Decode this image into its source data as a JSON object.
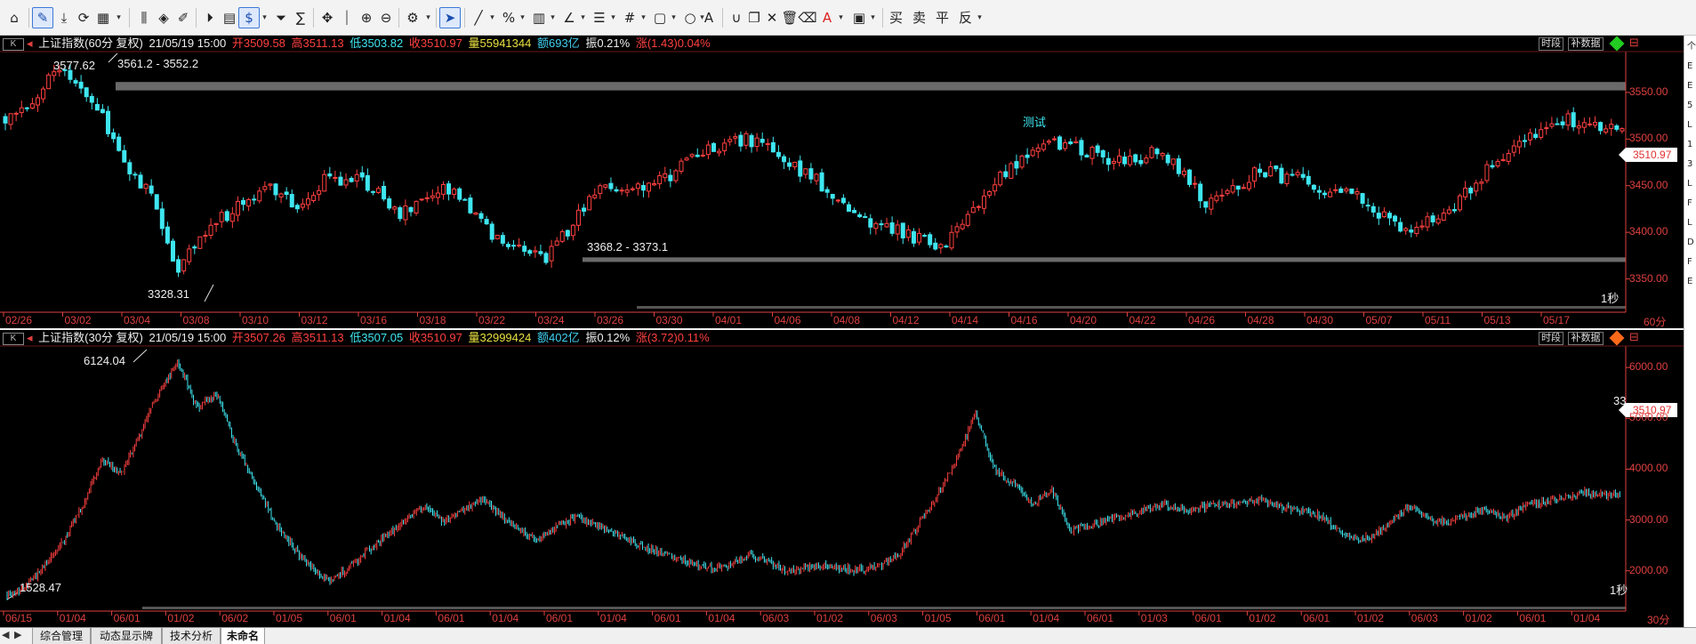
{
  "toolbar": {
    "buttons": [
      "home-icon",
      "draw-icon",
      "download-icon",
      "refresh-icon",
      "layout-icon",
      "indicator-icon",
      "diamond-icon",
      "edit-icon",
      "play-icon",
      "clipboard-icon",
      "dollar-icon",
      "funnel-icon",
      "formula-icon",
      "move-icon",
      "cursor-line-icon",
      "zoom-in-icon",
      "zoom-out-icon",
      "settings-icon",
      "pointer-icon",
      "line-tool-icon",
      "percent-icon",
      "ruler-icon",
      "angle-icon",
      "parallel-icon",
      "grid-icon",
      "rect-icon",
      "circle-icon",
      "text-icon",
      "magnet-icon",
      "copy-icon",
      "delete-icon",
      "lock-icon",
      "erase-icon",
      "color-icon",
      "save-icon"
    ],
    "text_buttons": [
      "买",
      "卖",
      "平",
      "反"
    ]
  },
  "top_panel": {
    "index_name": "上证指数(60分 复权)",
    "date_time": "21/05/19 15:00",
    "open_label": "开",
    "open": "3509.58",
    "high_label": "高",
    "high": "3511.13",
    "low_label": "低",
    "low": "3503.82",
    "close_label": "收",
    "close": "3510.97",
    "volume_label": "量",
    "volume": "55941344",
    "amount_label": "额",
    "amount": "693亿",
    "amp_label": "振",
    "amp": "0.21%",
    "change_label": "涨",
    "change": "(1.43)0.04%",
    "btn_time": "时段",
    "btn_fill": "补数据",
    "period": "60分",
    "interval": "1秒",
    "note": "测试",
    "max_label": "3577.62",
    "min_label": "3328.31",
    "band_top": "3561.2 - 3552.2",
    "band_bottom": "3368.2 - 3373.1",
    "last_price": "3510.97",
    "y_ticks": [
      "3550.00",
      "3500.00",
      "3450.00",
      "3400.00",
      "3350.00"
    ],
    "x_ticks": [
      "02/26",
      "03/02",
      "03/04",
      "03/08",
      "03/10",
      "03/12",
      "03/16",
      "03/18",
      "03/22",
      "03/24",
      "03/26",
      "03/30",
      "04/01",
      "04/06",
      "04/08",
      "04/12",
      "04/14",
      "04/16",
      "04/20",
      "04/22",
      "04/26",
      "04/28",
      "04/30",
      "05/07",
      "05/11",
      "05/13",
      "05/17"
    ]
  },
  "bottom_panel": {
    "index_name": "上证指数(30分 复权)",
    "date_time": "21/05/19 15:00",
    "open_label": "开",
    "open": "3507.26",
    "high_label": "高",
    "high": "3511.13",
    "low_label": "低",
    "low": "3507.05",
    "close_label": "收",
    "close": "3510.97",
    "volume_label": "量",
    "volume": "32999424",
    "amount_label": "额",
    "amount": "402亿",
    "amp_label": "振",
    "amp": "0.12%",
    "change_label": "涨",
    "change": "(3.72)0.11%",
    "btn_time": "时段",
    "btn_fill": "补数据",
    "period": "30分",
    "interval": "1秒",
    "max_label": "6124.04",
    "min_label": "1528.47",
    "side_label": "33",
    "last_price": "3510.97",
    "y_ticks": [
      "6000.00",
      "5000.00",
      "4000.00",
      "3000.00",
      "2000.00"
    ],
    "x_ticks": [
      "06/15",
      "01/04",
      "06/01",
      "01/02",
      "06/02",
      "01/05",
      "06/01",
      "01/04",
      "06/01",
      "01/04",
      "06/01",
      "01/04",
      "06/01",
      "01/04",
      "06/03",
      "01/02",
      "06/03",
      "01/05",
      "06/01",
      "01/04",
      "06/01",
      "01/03",
      "06/01",
      "01/02",
      "06/01",
      "01/02",
      "06/03",
      "01/02",
      "06/01",
      "01/04"
    ]
  },
  "tabs": [
    "综合管理",
    "动态显示牌",
    "技术分析",
    "未命名"
  ],
  "right_panel": {
    "chars": [
      "个",
      "E",
      "E",
      "5",
      "L",
      "1",
      "3",
      "L",
      "F",
      "L",
      "D",
      "F",
      "E"
    ]
  },
  "colors": {
    "up": "#ff4040",
    "down": "#3ee6f0",
    "axis": "#e04040",
    "band": "#6a6a6a",
    "accent_blue": "#3c78d8"
  },
  "chart_data": [
    {
      "type": "candlestick",
      "title": "上证指数(60分 复权)",
      "period": "60分",
      "ylim": [
        3320,
        3590
      ],
      "y_ticks": [
        3350,
        3400,
        3450,
        3500,
        3550
      ],
      "x_categories": [
        "02/26",
        "03/02",
        "03/04",
        "03/08",
        "03/10",
        "03/12",
        "03/16",
        "03/18",
        "03/22",
        "03/24",
        "03/26",
        "03/30",
        "04/01",
        "04/06",
        "04/08",
        "04/12",
        "04/14",
        "04/16",
        "04/20",
        "04/22",
        "04/26",
        "04/28",
        "04/30",
        "05/07",
        "05/11",
        "05/13",
        "05/17"
      ],
      "close_path": [
        3525,
        3540,
        3570,
        3560,
        3520,
        3470,
        3440,
        3360,
        3400,
        3420,
        3440,
        3445,
        3430,
        3455,
        3460,
        3450,
        3420,
        3435,
        3445,
        3420,
        3390,
        3385,
        3375,
        3405,
        3440,
        3450,
        3445,
        3460,
        3480,
        3490,
        3500,
        3495,
        3470,
        3455,
        3430,
        3415,
        3405,
        3395,
        3385,
        3410,
        3450,
        3470,
        3490,
        3495,
        3485,
        3480,
        3475,
        3490,
        3460,
        3430,
        3445,
        3470,
        3460,
        3455,
        3445,
        3440,
        3420,
        3400,
        3415,
        3430,
        3460,
        3480,
        3500,
        3520,
        3520,
        3515,
        3511
      ],
      "annotations": {
        "high": 3577.62,
        "low": 3328.31,
        "band_top": [
          3552.2,
          3561.2
        ],
        "band_bottom": [
          3368.2,
          3373.1
        ],
        "last": 3510.97
      }
    },
    {
      "type": "candlestick",
      "title": "上证指数(30分 复权)",
      "period": "30分",
      "ylim": [
        1400,
        6300
      ],
      "y_ticks": [
        2000,
        3000,
        4000,
        5000,
        6000
      ],
      "close_path": [
        1528,
        1700,
        2100,
        2600,
        3300,
        4200,
        3900,
        4700,
        5500,
        6124,
        5200,
        5500,
        4500,
        3800,
        3000,
        2500,
        2050,
        1800,
        2050,
        2400,
        2700,
        3000,
        3300,
        2950,
        3200,
        3400,
        3100,
        2800,
        2600,
        2900,
        3050,
        2900,
        2750,
        2550,
        2400,
        2300,
        2150,
        2050,
        2100,
        2300,
        2200,
        2000,
        2050,
        2100,
        2050,
        2000,
        2100,
        2350,
        2900,
        3500,
        4200,
        5100,
        4000,
        3700,
        3300,
        3600,
        2800,
        2900,
        3000,
        3100,
        3200,
        3300,
        3200,
        3250,
        3300,
        3350,
        3400,
        3250,
        3200,
        3100,
        2850,
        2600,
        2700,
        3000,
        3300,
        3000,
        2950,
        3100,
        3200,
        3050,
        3300,
        3350,
        3450,
        3550,
        3500,
        3511
      ],
      "annotations": {
        "high": 6124.04,
        "low": 1528.47,
        "last": 3510.97
      }
    }
  ]
}
